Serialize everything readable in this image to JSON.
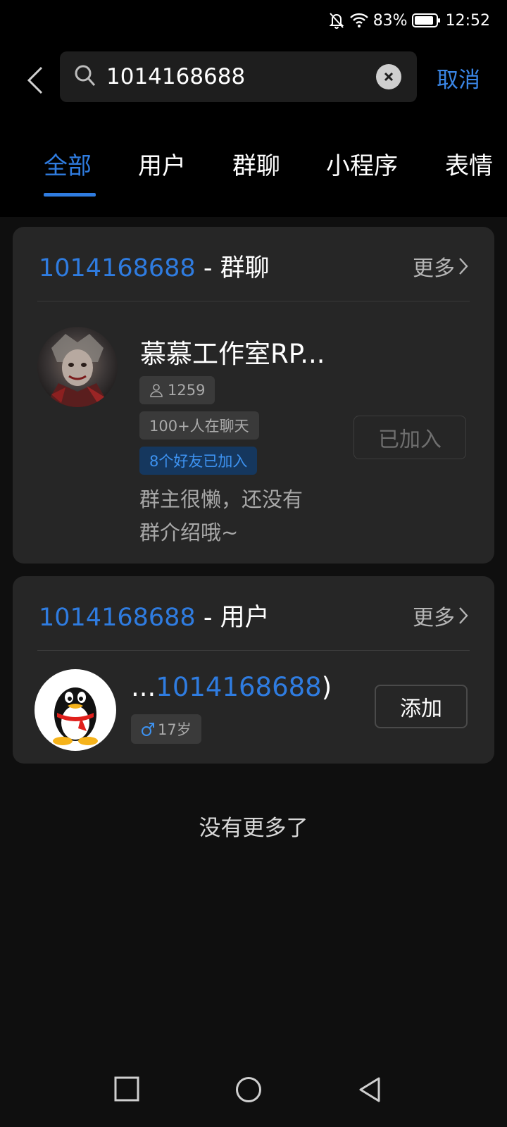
{
  "status_bar": {
    "battery": "83%",
    "time": "12:52"
  },
  "search": {
    "query": "1014168688",
    "cancel_label": "取消"
  },
  "tabs": [
    {
      "label": "全部",
      "active": true
    },
    {
      "label": "用户",
      "active": false
    },
    {
      "label": "群聊",
      "active": false
    },
    {
      "label": "小程序",
      "active": false
    },
    {
      "label": "表情",
      "active": false
    }
  ],
  "group_section": {
    "keyword": "1014168688",
    "separator": " - ",
    "category": "群聊",
    "more_label": "更多",
    "result": {
      "name": "慕慕工作室RP...",
      "member_count": "1259",
      "active_chat": "100+人在聊天",
      "friends_joined": "8个好友已加入",
      "description": "群主很懒，还没有群介绍哦~",
      "action_label": "已加入"
    }
  },
  "user_section": {
    "keyword": "1014168688",
    "separator": " - ",
    "category": "用户",
    "more_label": "更多",
    "result": {
      "name_prefix": "...",
      "name_match": "1014168688",
      "name_suffix": ")",
      "gender_icon": "male-icon",
      "age": "17岁",
      "action_label": "添加"
    }
  },
  "footer_text": "没有更多了",
  "colors": {
    "accent": "#2f7ce0",
    "background": "#0f0f0f",
    "card": "#262626"
  }
}
